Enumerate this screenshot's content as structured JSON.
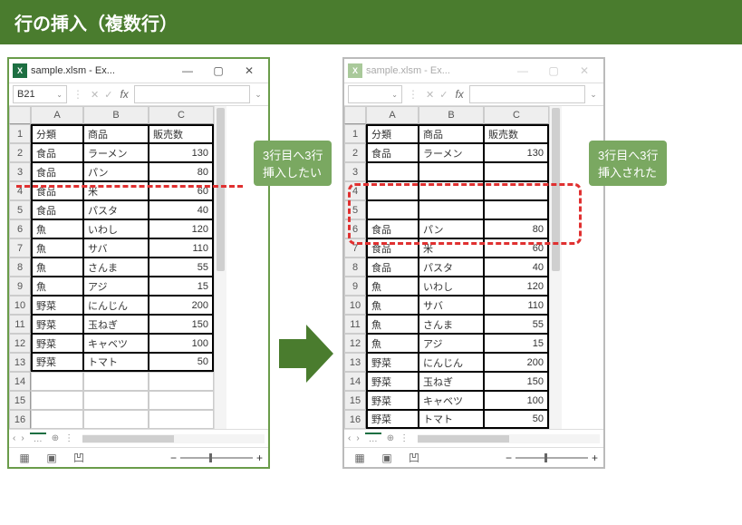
{
  "banner": "行の挿入（複数行）",
  "left": {
    "title": "sample.xlsm - Ex...",
    "namebox": "B21",
    "cols": [
      "A",
      "B",
      "C"
    ],
    "headers": [
      "分類",
      "商品",
      "販売数"
    ],
    "rows": [
      {
        "n": 1,
        "a": "分類",
        "b": "商品",
        "c": "販売数",
        "hdr": true
      },
      {
        "n": 2,
        "a": "食品",
        "b": "ラーメン",
        "c": "130"
      },
      {
        "n": 3,
        "a": "食品",
        "b": "パン",
        "c": "80"
      },
      {
        "n": 4,
        "a": "食品",
        "b": "米",
        "c": "60"
      },
      {
        "n": 5,
        "a": "食品",
        "b": "パスタ",
        "c": "40"
      },
      {
        "n": 6,
        "a": "魚",
        "b": "いわし",
        "c": "120"
      },
      {
        "n": 7,
        "a": "魚",
        "b": "サバ",
        "c": "110"
      },
      {
        "n": 8,
        "a": "魚",
        "b": "さんま",
        "c": "55"
      },
      {
        "n": 9,
        "a": "魚",
        "b": "アジ",
        "c": "15"
      },
      {
        "n": 10,
        "a": "野菜",
        "b": "にんじん",
        "c": "200"
      },
      {
        "n": 11,
        "a": "野菜",
        "b": "玉ねぎ",
        "c": "150"
      },
      {
        "n": 12,
        "a": "野菜",
        "b": "キャベツ",
        "c": "100"
      },
      {
        "n": 13,
        "a": "野菜",
        "b": "トマト",
        "c": "50"
      },
      {
        "n": 14,
        "a": "",
        "b": "",
        "c": ""
      },
      {
        "n": 15,
        "a": "",
        "b": "",
        "c": ""
      },
      {
        "n": 16,
        "a": "",
        "b": "",
        "c": ""
      }
    ],
    "callout": "3行目へ3行\n挿入したい"
  },
  "right": {
    "title": "sample.xlsm - Ex...",
    "namebox": "",
    "cols": [
      "A",
      "B",
      "C"
    ],
    "rows": [
      {
        "n": 1,
        "a": "分類",
        "b": "商品",
        "c": "販売数",
        "hdr": true
      },
      {
        "n": 2,
        "a": "食品",
        "b": "ラーメン",
        "c": "130"
      },
      {
        "n": 3,
        "a": "",
        "b": "",
        "c": "",
        "blank": true
      },
      {
        "n": 4,
        "a": "",
        "b": "",
        "c": "",
        "blank": true
      },
      {
        "n": 5,
        "a": "",
        "b": "",
        "c": "",
        "blank": true
      },
      {
        "n": 6,
        "a": "食品",
        "b": "パン",
        "c": "80"
      },
      {
        "n": 7,
        "a": "食品",
        "b": "米",
        "c": "60"
      },
      {
        "n": 8,
        "a": "食品",
        "b": "パスタ",
        "c": "40"
      },
      {
        "n": 9,
        "a": "魚",
        "b": "いわし",
        "c": "120"
      },
      {
        "n": 10,
        "a": "魚",
        "b": "サバ",
        "c": "110"
      },
      {
        "n": 11,
        "a": "魚",
        "b": "さんま",
        "c": "55"
      },
      {
        "n": 12,
        "a": "魚",
        "b": "アジ",
        "c": "15"
      },
      {
        "n": 13,
        "a": "野菜",
        "b": "にんじん",
        "c": "200"
      },
      {
        "n": 14,
        "a": "野菜",
        "b": "玉ねぎ",
        "c": "150"
      },
      {
        "n": 15,
        "a": "野菜",
        "b": "キャベツ",
        "c": "100"
      },
      {
        "n": 16,
        "a": "野菜",
        "b": "トマト",
        "c": "50"
      }
    ],
    "callout": "3行目へ3行\n挿入された"
  },
  "icons": {
    "min": "—",
    "max": "▢",
    "close": "✕",
    "dd": "⌄",
    "chk": "✓",
    "x": "✕",
    "fx": "fx",
    "left": "‹",
    "right": "›",
    "dots": "…",
    "plus": "⊕"
  }
}
